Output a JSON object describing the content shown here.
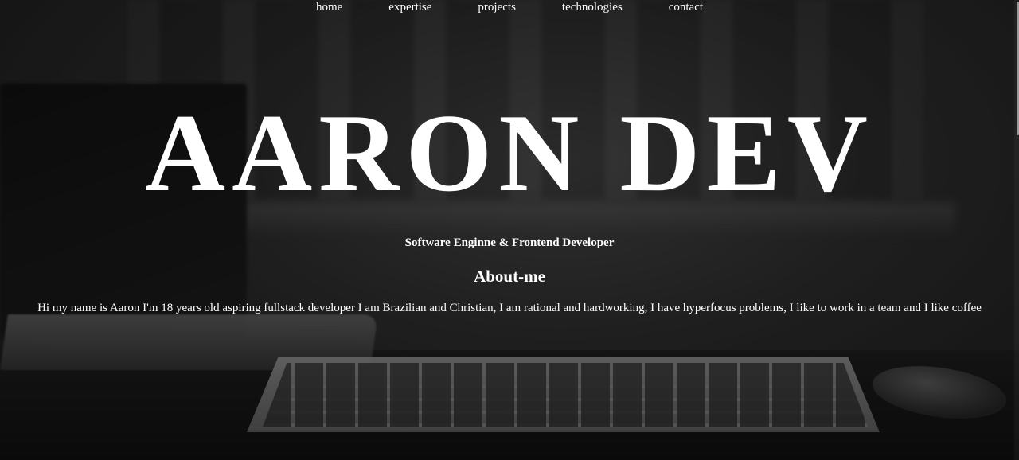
{
  "nav": {
    "items": [
      {
        "label": "home"
      },
      {
        "label": "expertise"
      },
      {
        "label": "projects"
      },
      {
        "label": "technologies"
      },
      {
        "label": "contact"
      }
    ]
  },
  "hero": {
    "title": "AARON DEV",
    "subtitle": "Software Enginne & Frontend Developer"
  },
  "about": {
    "heading": "About-me",
    "text": "Hi my name is Aaron I'm 18 years old aspiring fullstack developer  I am Brazilian and Christian, I am rational and hardworking, I have hyperfocus problems, I like to work in a team and I like coffee"
  },
  "colors": {
    "text": "#ffffff",
    "background": "#1a1a1a"
  }
}
